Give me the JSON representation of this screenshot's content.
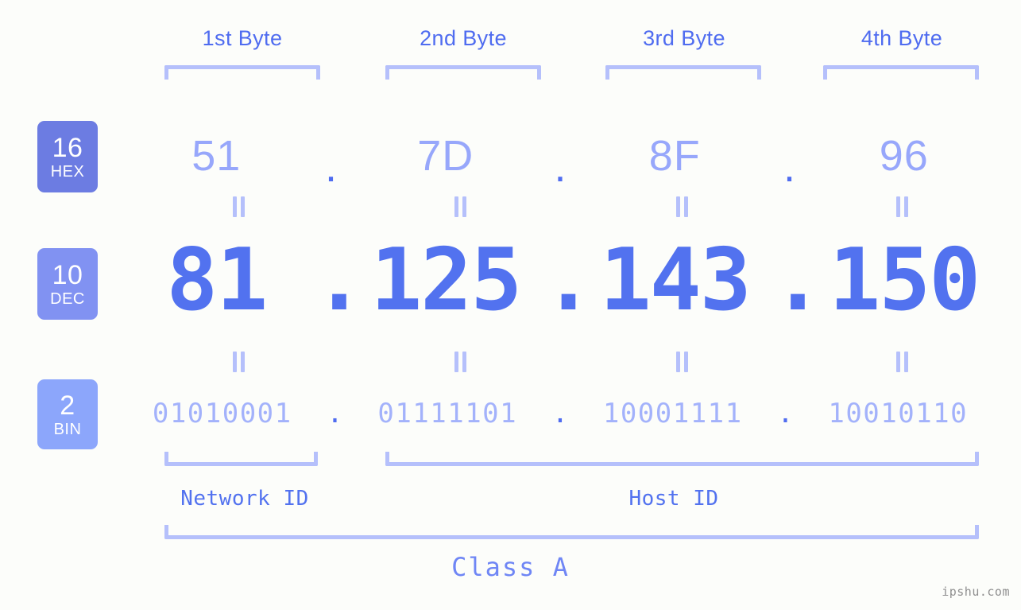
{
  "ip_address": "81.125.143.150",
  "colors": {
    "background": "#fcfdfa",
    "accent_strong": "#4f6cf0",
    "accent_mid": "#8192f2",
    "accent_light": "#b5c0fb",
    "badge_hex": "#6c7ce2",
    "badge_dec": "#8192f2",
    "badge_bin": "#8ca6fb"
  },
  "byte_headers": [
    {
      "label": "1st Byte"
    },
    {
      "label": "2nd Byte"
    },
    {
      "label": "3rd Byte"
    },
    {
      "label": "4th Byte"
    }
  ],
  "bases": [
    {
      "number": "16",
      "abbr": "HEX"
    },
    {
      "number": "10",
      "abbr": "DEC"
    },
    {
      "number": "2",
      "abbr": "BIN"
    }
  ],
  "rows": {
    "hex": {
      "base": "16",
      "name": "HEX",
      "values": [
        "51",
        "7D",
        "8F",
        "96"
      ],
      "separator": "."
    },
    "dec": {
      "base": "10",
      "name": "DEC",
      "values": [
        "81",
        "125",
        "143",
        "150"
      ],
      "separator": "."
    },
    "bin": {
      "base": "2",
      "name": "BIN",
      "values": [
        "01010001",
        "01111101",
        "10001111",
        "10010110"
      ],
      "separator": "."
    }
  },
  "equality_marks": {
    "glyph": "equals-rotated",
    "count_per_gap": 4
  },
  "segments": {
    "network_id": "Network ID",
    "host_id": "Host ID",
    "class": "Class A"
  },
  "watermark": "ipshu.com"
}
